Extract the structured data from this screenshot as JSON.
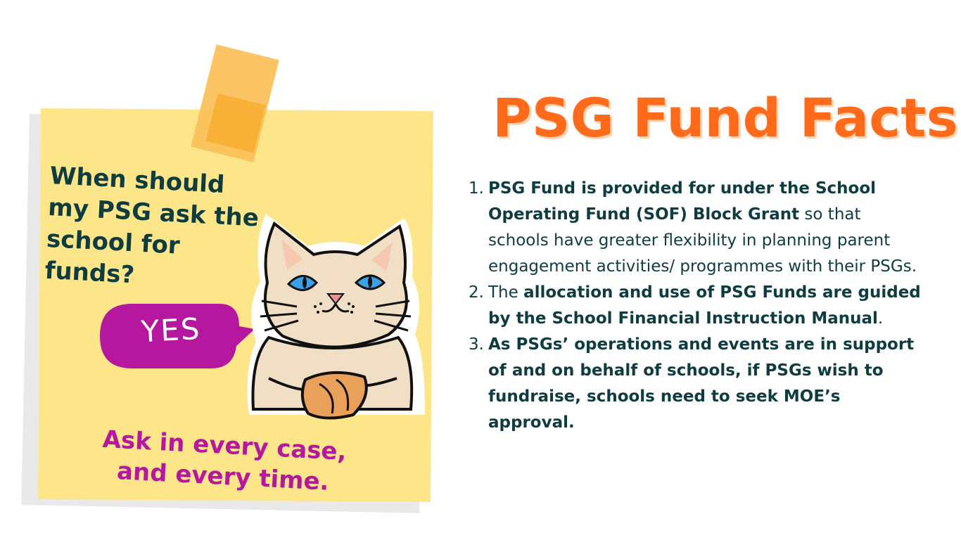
{
  "note": {
    "question": "When should my PSG ask the school for funds?",
    "bubble": "YES",
    "answer": "Ask in every case, and every time."
  },
  "title": "PSG Fund Facts",
  "facts": [
    {
      "num": "1.",
      "bold": "PSG Fund is provided for under the School Operating Fund (SOF) Block Grant",
      "text_after": " so that schools have greater flexibility in planning parent engagement activities/ programmes with their PSGs."
    },
    {
      "num": "2.",
      "text_before": "The ",
      "bold": "allocation and use of PSG Funds are guided by the School Financial Instruction Manual",
      "text_after": "."
    },
    {
      "num": "3.",
      "bold": " As PSGs’ operations and events are in support of and on behalf of schools, if PSGs wish to fundraise, schools need to seek MOE’s approval."
    }
  ],
  "colors": {
    "title": "#ff6b1a",
    "text": "#0e3c40",
    "note": "#fde68a",
    "bubble": "#b5179e",
    "answer": "#b5179e",
    "tape": "#fbbf55"
  },
  "icons": {
    "cat": "cat-illustration"
  }
}
